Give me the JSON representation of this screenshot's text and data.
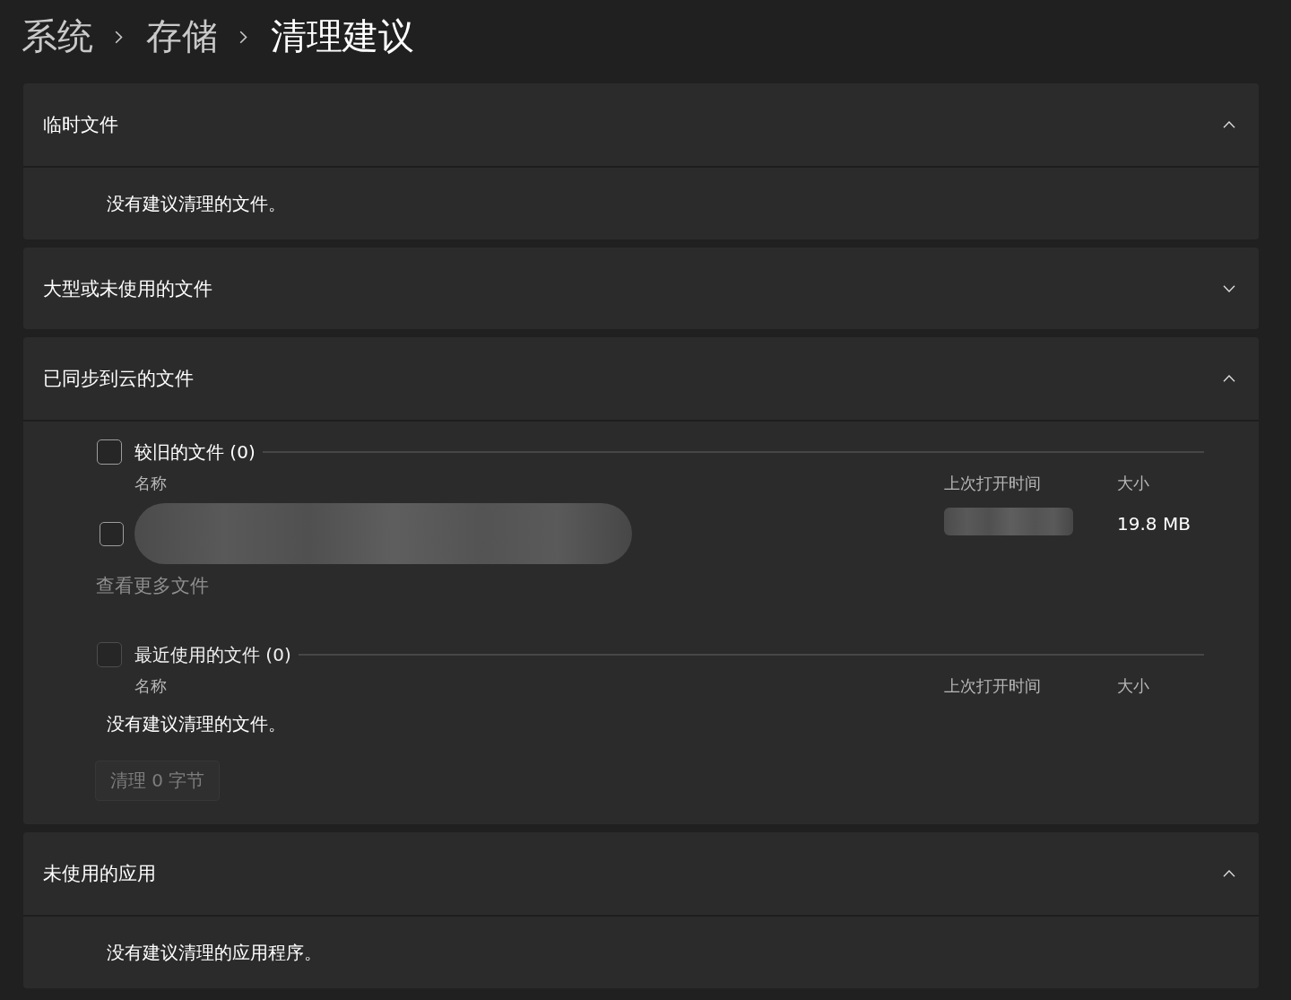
{
  "breadcrumb": [
    {
      "label": "系统",
      "current": false
    },
    {
      "label": "存储",
      "current": false
    },
    {
      "label": "清理建议",
      "current": true
    }
  ],
  "sections": [
    {
      "title": "临时文件",
      "expanded": true,
      "kind": "message",
      "message": "没有建议清理的文件。"
    },
    {
      "title": "大型或未使用的文件",
      "expanded": false
    },
    {
      "title": "已同步到云的文件",
      "expanded": true,
      "kind": "groups",
      "groups": [
        {
          "title": "较旧的文件 (0)",
          "checked": false,
          "disabled": false,
          "columns": [
            "名称",
            "上次打开时间",
            "大小"
          ],
          "rows": [
            {
              "checked": false,
              "size": "19.8 MB"
            }
          ],
          "more_link": "查看更多文件"
        },
        {
          "title": "最近使用的文件 (0)",
          "checked": false,
          "disabled": true,
          "columns": [
            "名称",
            "上次打开时间",
            "大小"
          ],
          "message": "没有建议清理的文件。"
        }
      ],
      "button": {
        "label": "清理 0 字节",
        "disabled": true
      }
    },
    {
      "title": "未使用的应用",
      "expanded": true,
      "kind": "message",
      "message": "没有建议清理的应用程序。"
    }
  ]
}
